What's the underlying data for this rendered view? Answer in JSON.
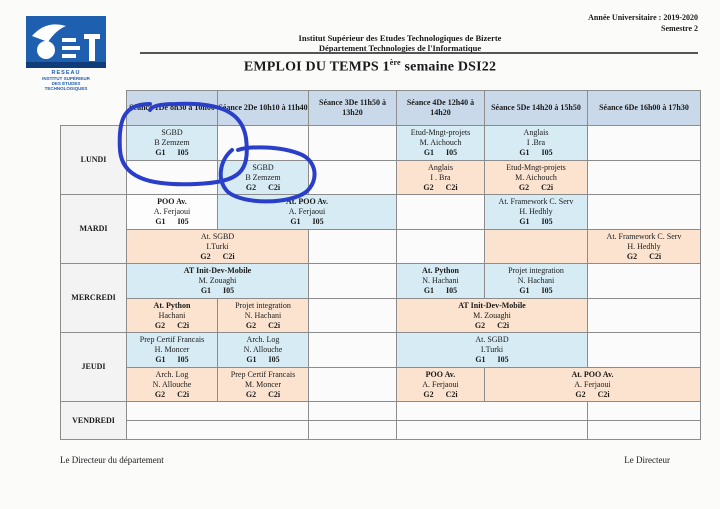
{
  "header": {
    "academic_year": "Année Universitaire : 2019-2020",
    "semester": "Semestre 2",
    "institute": "Institut Supérieur des Etudes Technologiques de Bizerte",
    "department": "Département Technologies de l'Informatique",
    "title_prefix": "EMPLOI DU TEMPS 1",
    "title_sup": "ère",
    "title_suffix": " semaine DSI22"
  },
  "logo": {
    "mark": "iset",
    "line1": "RESEAU",
    "line2": "INSTITUT SUPÉRIEUR",
    "line3": "DES ÉTUDES",
    "line4": "TECHNOLOGIQUES"
  },
  "sessions": [
    {
      "name": "Séance 1",
      "time": "De 8h30 à 10h00"
    },
    {
      "name": "Séance 2",
      "time": "De 10h10 à 11h40"
    },
    {
      "name": "Séance 3",
      "time": "De 11h50 à 13h20"
    },
    {
      "name": "Séance 4",
      "time": "De 12h40 à 14h20"
    },
    {
      "name": "Séance 5",
      "time": "De 14h20 à 15h50"
    },
    {
      "name": "Séance 6",
      "time": "De 16h00 à 17h30"
    }
  ],
  "days": [
    "LUNDI",
    "MARDI",
    "MERCREDI",
    "JEUDI",
    "VENDREDI"
  ],
  "lundi": {
    "a1": {
      "course": "SGBD",
      "teacher": "B Zemzem",
      "group": "G1",
      "room": "I05"
    },
    "a4": {
      "course": "Etud-Mngt-projets",
      "teacher": "M. Aichouch",
      "group": "G1",
      "room": "I05"
    },
    "a5": {
      "course": "Anglais",
      "teacher": "I .Bra",
      "group": "G1",
      "room": "I05"
    },
    "b2": {
      "course": "SGBD",
      "teacher": "B Zemzem",
      "group": "G2",
      "room": "C2i"
    },
    "b4": {
      "course": "Anglais",
      "teacher": "I . Bra",
      "group": "G2",
      "room": "C2i"
    },
    "b5": {
      "course": "Etud-Mngt-projets",
      "teacher": "M. Aichouch",
      "group": "G2",
      "room": "C2i"
    }
  },
  "mardi": {
    "a1": {
      "course": "POO Av.",
      "teacher": "A. Ferjaoui",
      "group": "G1",
      "room": "I05"
    },
    "a2": {
      "course": "At. POO Av.",
      "teacher": "A. Ferjaoui",
      "group": "G1",
      "room": "I05"
    },
    "a5": {
      "course": "At. Framework C. Serv",
      "teacher": "H. Hedhly",
      "group": "G1",
      "room": "I05"
    },
    "b1": {
      "course": "At. SGBD",
      "teacher": "I.Turki",
      "group": "G2",
      "room": "C2i"
    },
    "b6": {
      "course": "At. Framework C. Serv",
      "teacher": "H. Hedhly",
      "group": "G2",
      "room": "C2i"
    }
  },
  "mercredi": {
    "a1": {
      "course": "AT Init-Dev-Mobile",
      "teacher": "M. Zouaghi",
      "group": "G1",
      "room": "I05"
    },
    "a4": {
      "course": "At. Python",
      "teacher": "N. Hachani",
      "group": "G1",
      "room": "I05"
    },
    "a5": {
      "course": "Projet integration",
      "teacher": "N. Hachani",
      "group": "G1",
      "room": "I05"
    },
    "b1": {
      "course": "At. Python",
      "teacher": "Hachani",
      "group": "G2",
      "room": "C2i"
    },
    "b2": {
      "course": "Projet integration",
      "teacher": "N. Hachani",
      "group": "G2",
      "room": "C2i"
    },
    "b4": {
      "course": "AT Init-Dev-Mobile",
      "teacher": "M. Zouaghi",
      "group": "G2",
      "room": "C2i"
    }
  },
  "jeudi": {
    "a1": {
      "course": "Prep Certif Francais",
      "teacher": "H. Moncer",
      "group": "G1",
      "room": "I05"
    },
    "a2": {
      "course": "Arch. Log",
      "teacher": "N. Allouche",
      "group": "G1",
      "room": "I05"
    },
    "a4": {
      "course": "At. SGBD",
      "teacher": "I.Turki",
      "group": "G1",
      "room": "I05"
    },
    "b1": {
      "course": "Arch. Log",
      "teacher": "N. Allouche",
      "group": "G2",
      "room": "C2i"
    },
    "b2": {
      "course": "Prep Certif Francais",
      "teacher": "M. Moncer",
      "group": "G2",
      "room": "C2i"
    },
    "b4": {
      "course": "POO Av.",
      "teacher": "A. Ferjaoui",
      "group": "G2",
      "room": "C2i"
    },
    "b5": {
      "course": "At. POO Av.",
      "teacher": "A. Ferjaoui",
      "group": "G2",
      "room": "C2i"
    }
  },
  "footer": {
    "left": "Le Directeur du département",
    "right": "Le Directeur"
  },
  "colors": {
    "header": "#c9d9ea",
    "group1": "#d6ebf4",
    "group2": "#fbe3cf",
    "ink": "#2a3fc9"
  }
}
